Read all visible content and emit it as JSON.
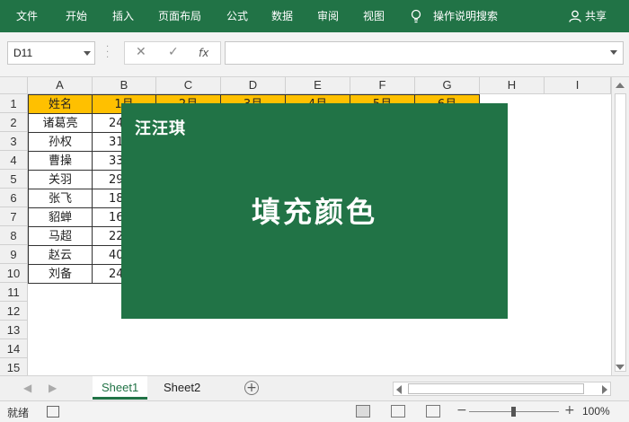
{
  "ribbon": {
    "tabs": [
      "文件",
      "开始",
      "插入",
      "页面布局",
      "公式",
      "数据",
      "审阅",
      "视图"
    ],
    "tell_me": "操作说明搜索",
    "share": "共享"
  },
  "formula_bar": {
    "name_box": "D11",
    "cancel_icon": "✕",
    "enter_icon": "✓",
    "fx_label": "fx",
    "value": ""
  },
  "grid": {
    "columns": [
      "A",
      "B",
      "C",
      "D",
      "E",
      "F",
      "G",
      "H",
      "I"
    ],
    "rows": [
      "1",
      "2",
      "3",
      "4",
      "5",
      "6",
      "7",
      "8",
      "9",
      "10",
      "11",
      "12",
      "13",
      "14",
      "15"
    ],
    "header_row": [
      "姓名",
      "1月",
      "2月",
      "3月",
      "4月",
      "5月",
      "6月"
    ],
    "names": [
      "诸葛亮",
      "孙权",
      "曹操",
      "关羽",
      "张飞",
      "貂蝉",
      "马超",
      "赵云",
      "刘备"
    ],
    "b_values": [
      "24",
      "31",
      "33",
      "29",
      "18",
      "16",
      "22",
      "40",
      "24"
    ],
    "header_fill": "#ffc000"
  },
  "overlay": {
    "brand": "汪汪琪",
    "title": "填充颜色",
    "color": "#217346"
  },
  "sheets": {
    "tabs": [
      "Sheet1",
      "Sheet2"
    ],
    "active": "Sheet1",
    "add_label": "+"
  },
  "status": {
    "ready": "就绪",
    "zoom_minus": "−",
    "zoom_plus": "+",
    "zoom": "100%"
  },
  "accent": "#217346"
}
